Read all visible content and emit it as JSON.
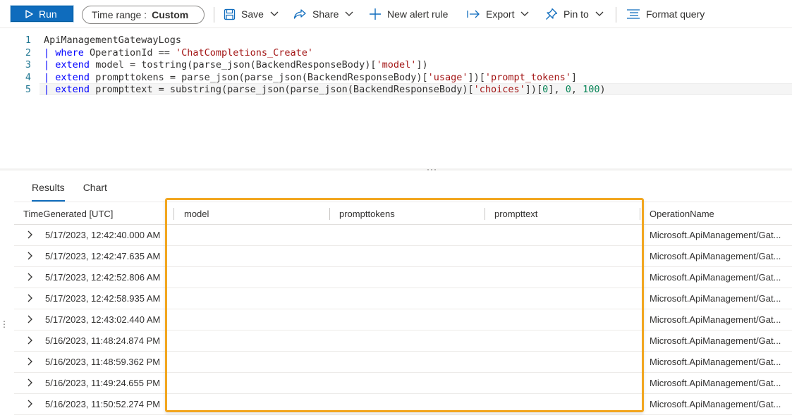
{
  "toolbar": {
    "run_label": "Run",
    "time_range_label": "Time range :",
    "time_range_value": "Custom",
    "save_label": "Save",
    "share_label": "Share",
    "new_alert_label": "New alert rule",
    "export_label": "Export",
    "pin_label": "Pin to",
    "format_label": "Format query"
  },
  "editor": {
    "line_numbers": [
      "1",
      "2",
      "3",
      "4",
      "5"
    ]
  },
  "results": {
    "tabs": [
      "Results",
      "Chart"
    ],
    "columns": [
      "TimeGenerated [UTC]",
      "model",
      "prompttokens",
      "prompttext",
      "OperationName"
    ],
    "rows": [
      {
        "time": "5/17/2023, 12:42:40.000 AM",
        "model": "",
        "prompttokens": "",
        "prompttext": "",
        "operation": "Microsoft.ApiManagement/Gat..."
      },
      {
        "time": "5/17/2023, 12:42:47.635 AM",
        "model": "",
        "prompttokens": "",
        "prompttext": "",
        "operation": "Microsoft.ApiManagement/Gat..."
      },
      {
        "time": "5/17/2023, 12:42:52.806 AM",
        "model": "",
        "prompttokens": "",
        "prompttext": "",
        "operation": "Microsoft.ApiManagement/Gat..."
      },
      {
        "time": "5/17/2023, 12:42:58.935 AM",
        "model": "",
        "prompttokens": "",
        "prompttext": "",
        "operation": "Microsoft.ApiManagement/Gat..."
      },
      {
        "time": "5/17/2023, 12:43:02.440 AM",
        "model": "",
        "prompttokens": "",
        "prompttext": "",
        "operation": "Microsoft.ApiManagement/Gat..."
      },
      {
        "time": "5/16/2023, 11:48:24.874 PM",
        "model": "",
        "prompttokens": "",
        "prompttext": "",
        "operation": "Microsoft.ApiManagement/Gat..."
      },
      {
        "time": "5/16/2023, 11:48:59.362 PM",
        "model": "",
        "prompttokens": "",
        "prompttext": "",
        "operation": "Microsoft.ApiManagement/Gat..."
      },
      {
        "time": "5/16/2023, 11:49:24.655 PM",
        "model": "",
        "prompttokens": "",
        "prompttext": "",
        "operation": "Microsoft.ApiManagement/Gat..."
      },
      {
        "time": "5/16/2023, 11:50:52.274 PM",
        "model": "",
        "prompttokens": "",
        "prompttext": "",
        "operation": "Microsoft.ApiManagement/Gat..."
      }
    ]
  },
  "colors": {
    "accent": "#0f6cbd",
    "highlight_border": "#f2a61f",
    "keyword": "#0000ff",
    "string": "#a31515",
    "number": "#098658"
  },
  "icons": [
    "run-icon",
    "save-icon",
    "chevron-down-icon",
    "share-icon",
    "plus-icon",
    "export-icon",
    "pin-icon",
    "format-icon",
    "chevron-right-icon"
  ]
}
